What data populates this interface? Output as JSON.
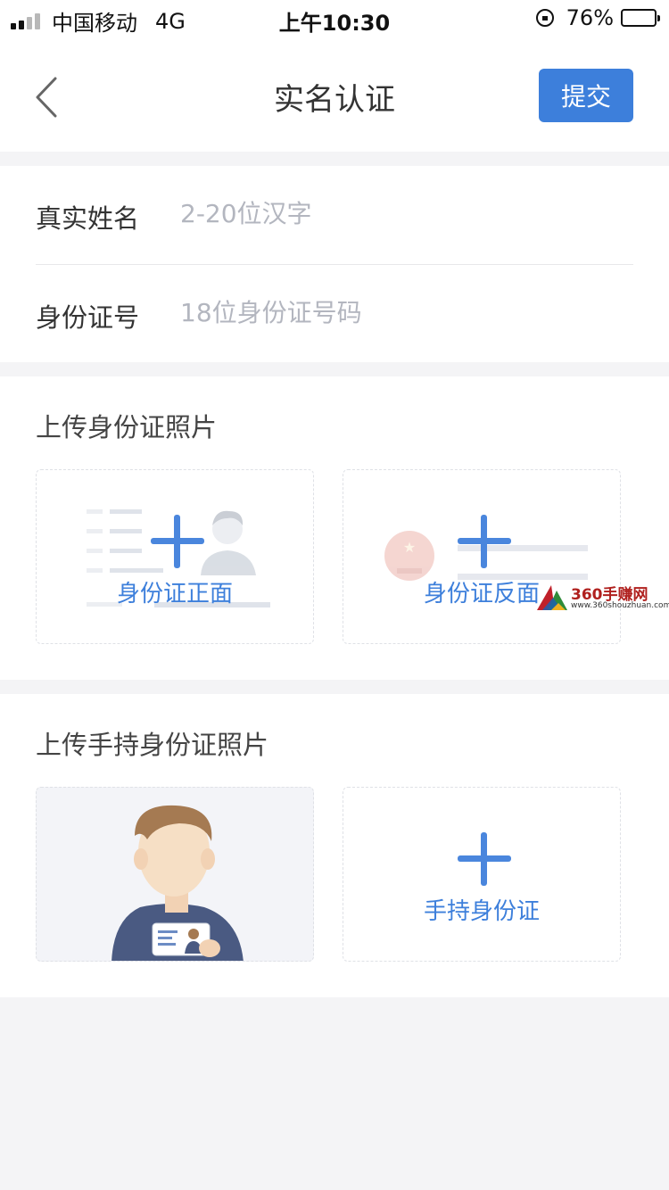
{
  "status_bar": {
    "carrier": "中国移动",
    "network": "4G",
    "time": "上午10:30",
    "battery": "76%",
    "battery_level": 0.76,
    "icons": [
      "signal-icon",
      "orientation-lock-icon",
      "battery-icon"
    ]
  },
  "nav": {
    "title": "实名认证",
    "submit_label": "提交",
    "back_icon": "chevron-left-icon"
  },
  "form": {
    "name_label": "真实姓名",
    "name_placeholder": "2-20位汉字",
    "id_label": "身份证号",
    "id_placeholder": "18位身份证号码"
  },
  "upload_id": {
    "title": "上传身份证照片",
    "front_label": "身份证正面",
    "back_label": "身份证反面"
  },
  "upload_handheld": {
    "title": "上传手持身份证照片",
    "handheld_label": "手持身份证"
  },
  "watermark": {
    "text": "360手赚网",
    "url": "www.360shouzhuan.com"
  },
  "colors": {
    "accent": "#3d7fdb",
    "page_background": "#f4f4f6",
    "placeholder": "#b3b6bf"
  }
}
